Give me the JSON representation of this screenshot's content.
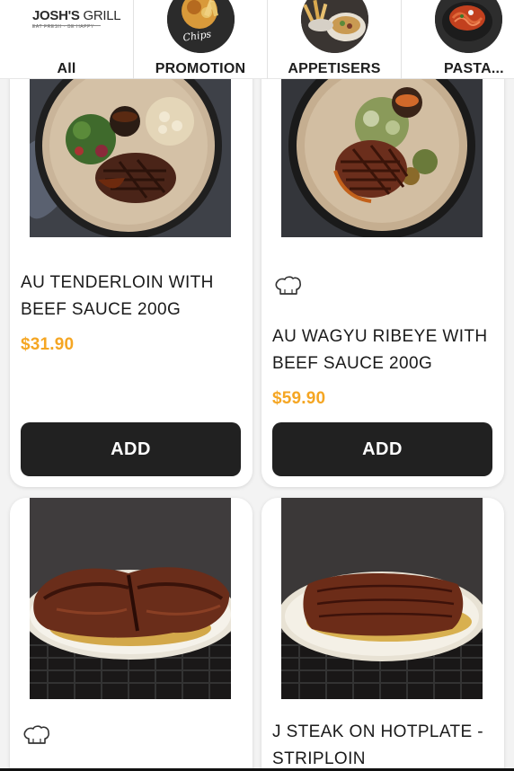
{
  "brand": {
    "name_bold": "JOSH'S",
    "name_thin": "GRILL",
    "tagline": "EAT FRESH · BE HAPPY"
  },
  "categories": [
    {
      "label": "All"
    },
    {
      "label": "PROMOTION",
      "thumb_text": "FISH & CHIPS"
    },
    {
      "label": "APPETISERS"
    },
    {
      "label": "PASTA..."
    }
  ],
  "products": [
    {
      "name": "AU TENDERLOIN WITH BEEF SAUCE 200G",
      "price": "$31.90",
      "add_label": "ADD",
      "chef_icon": false
    },
    {
      "name": "AU WAGYU RIBEYE WITH BEEF SAUCE 200G",
      "price": "$59.90",
      "add_label": "ADD",
      "chef_icon": true
    },
    {
      "name": "",
      "price": "",
      "add_label": "",
      "chef_icon": true
    },
    {
      "name": "J STEAK ON HOTPLATE - STRIPLOIN",
      "price": "",
      "add_label": "",
      "chef_icon": false
    }
  ],
  "colors": {
    "price": "#f5a623",
    "button": "#212121",
    "background": "#f3f3f3"
  }
}
